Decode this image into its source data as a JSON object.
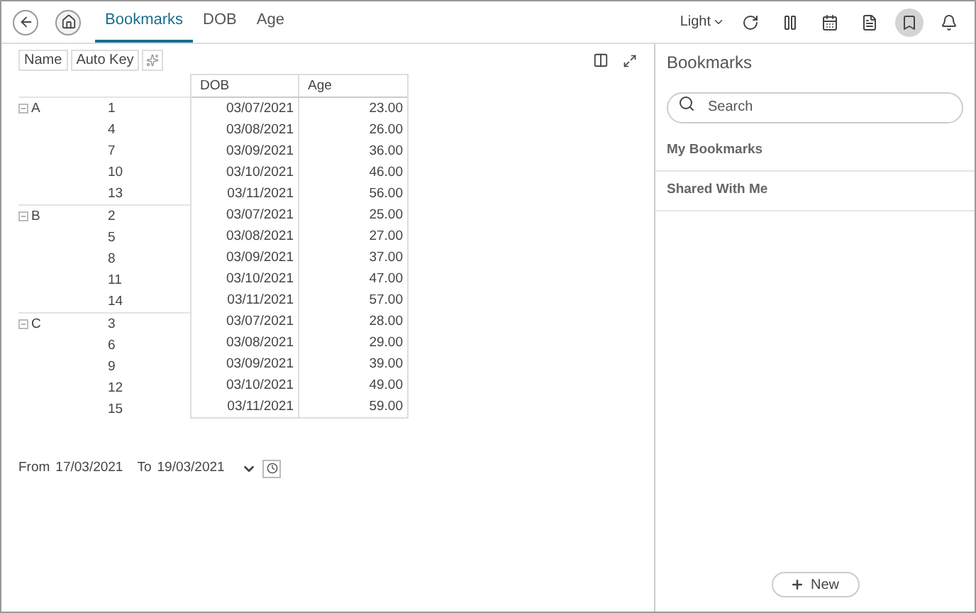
{
  "tabs": [
    {
      "label": "Bookmarks",
      "selected": true
    },
    {
      "label": "DOB",
      "selected": false
    },
    {
      "label": "Age",
      "selected": false
    }
  ],
  "theme": {
    "label": "Light"
  },
  "toolbar": [
    {
      "kind": "refresh"
    },
    {
      "kind": "pause"
    },
    {
      "kind": "calendar"
    },
    {
      "kind": "pdf"
    },
    {
      "kind": "bookmark",
      "selected": true
    },
    {
      "kind": "bell"
    }
  ],
  "chips": [
    {
      "label": "Name"
    },
    {
      "label": "Auto Key"
    }
  ],
  "table": {
    "columns": [
      "DOB",
      "Age"
    ],
    "groups": [
      {
        "label": "A",
        "expanded": true,
        "rows": [
          {
            "key": "1",
            "dob": "03/07/2021",
            "age": "23.00"
          },
          {
            "key": "4",
            "dob": "03/08/2021",
            "age": "26.00"
          },
          {
            "key": "7",
            "dob": "03/09/2021",
            "age": "36.00"
          },
          {
            "key": "10",
            "dob": "03/10/2021",
            "age": "46.00"
          },
          {
            "key": "13",
            "dob": "03/11/2021",
            "age": "56.00"
          }
        ]
      },
      {
        "label": "B",
        "expanded": true,
        "rows": [
          {
            "key": "2",
            "dob": "03/07/2021",
            "age": "25.00"
          },
          {
            "key": "5",
            "dob": "03/08/2021",
            "age": "27.00"
          },
          {
            "key": "8",
            "dob": "03/09/2021",
            "age": "37.00"
          },
          {
            "key": "11",
            "dob": "03/10/2021",
            "age": "47.00"
          },
          {
            "key": "14",
            "dob": "03/11/2021",
            "age": "57.00"
          }
        ]
      },
      {
        "label": "C",
        "expanded": true,
        "rows": [
          {
            "key": "3",
            "dob": "03/07/2021",
            "age": "28.00"
          },
          {
            "key": "6",
            "dob": "03/08/2021",
            "age": "29.00"
          },
          {
            "key": "9",
            "dob": "03/09/2021",
            "age": "39.00"
          },
          {
            "key": "12",
            "dob": "03/10/2021",
            "age": "49.00"
          },
          {
            "key": "15",
            "dob": "03/11/2021",
            "age": "59.00"
          }
        ]
      }
    ]
  },
  "date_range": {
    "from_label": "From",
    "from": "17/03/2021",
    "to_label": "To",
    "to": "19/03/2021"
  },
  "bookmarks_panel": {
    "title": "Bookmarks",
    "search": {
      "placeholder": "Search"
    },
    "sections": [
      {
        "label": "My Bookmarks"
      },
      {
        "label": "Shared With Me"
      }
    ],
    "new_button": {
      "label": "New"
    }
  }
}
